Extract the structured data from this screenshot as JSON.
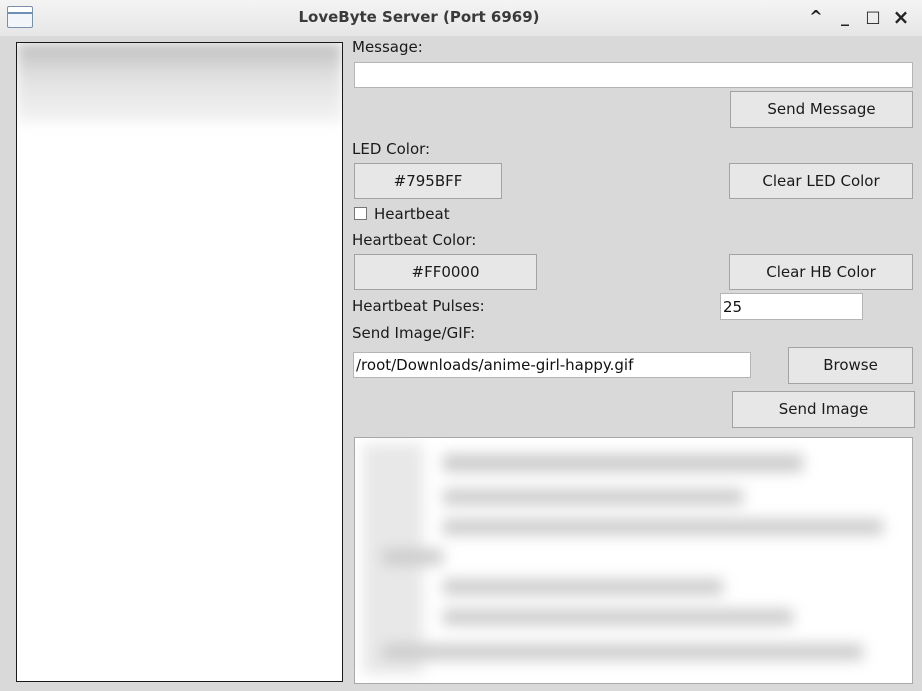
{
  "window": {
    "title": "LoveByte Server (Port 6969)",
    "controls": [
      "^",
      "_",
      "□",
      "×"
    ]
  },
  "message": {
    "label": "Message:",
    "value": "",
    "send_label": "Send Message"
  },
  "led": {
    "label": "LED Color:",
    "color_value": "#795BFF",
    "clear_label": "Clear LED Color"
  },
  "heartbeat": {
    "checkbox_label": "Heartbeat",
    "checked": false,
    "color_label": "Heartbeat Color:",
    "color_value": "#FF0000",
    "clear_label": "Clear HB Color",
    "pulses_label": "Heartbeat Pulses:",
    "pulses_value": "25"
  },
  "image": {
    "label": "Send Image/GIF:",
    "path_value": "/root/Downloads/anime-girl-happy.gif",
    "browse_label": "Browse",
    "send_label": "Send Image"
  }
}
